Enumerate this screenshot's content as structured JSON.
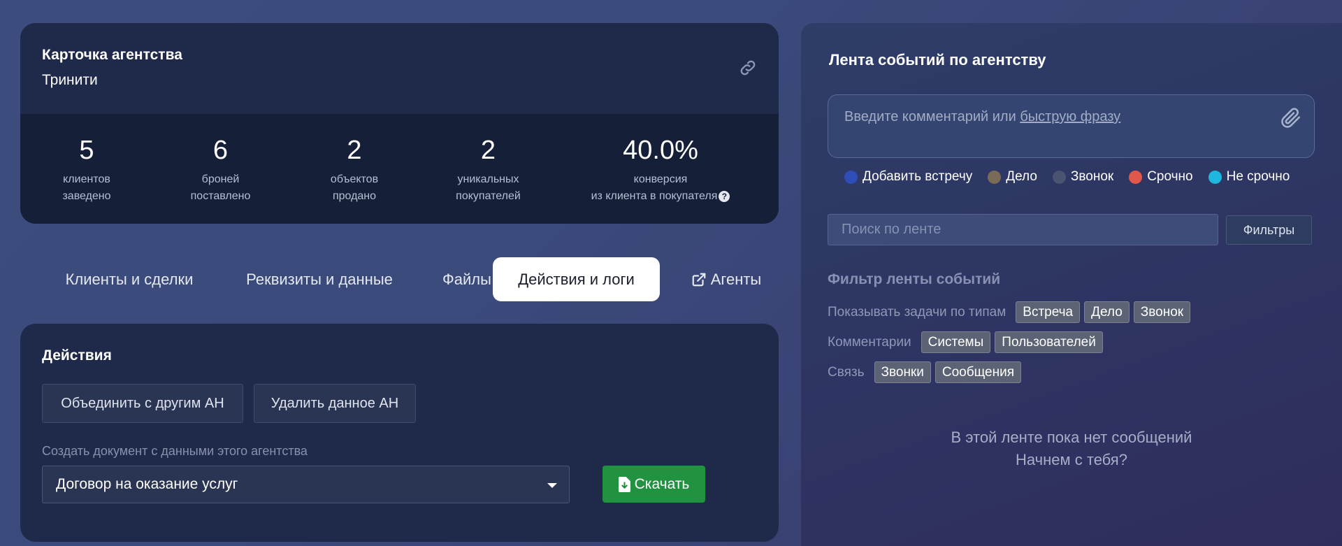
{
  "agency_card": {
    "title": "Карточка агентства",
    "name": "Тринити",
    "stats": [
      {
        "value": "5",
        "label_line1": "клиентов",
        "label_line2": "заведено"
      },
      {
        "value": "6",
        "label_line1": "броней",
        "label_line2": "поставлено"
      },
      {
        "value": "2",
        "label_line1": "объектов",
        "label_line2": "продано"
      },
      {
        "value": "2",
        "label_line1": "уникальных",
        "label_line2": "покупателей"
      },
      {
        "value": "40.0%",
        "label_line1": "конверсия",
        "label_line2": "из клиента в покупателя"
      }
    ]
  },
  "tabs": [
    {
      "label": "Клиенты и сделки"
    },
    {
      "label": "Реквизиты и данные"
    },
    {
      "label": "Файлы"
    },
    {
      "label": "Действия и логи",
      "active": true
    },
    {
      "label": "Агенты",
      "icon": "external-link-icon"
    }
  ],
  "actions": {
    "title": "Действия",
    "merge_label": "Объединить с другим АН",
    "delete_label": "Удалить данное АН",
    "doc_label": "Создать документ с данными этого агентства",
    "doc_selected": "Договор на оказание услуг",
    "download_label": "Скачать"
  },
  "feed": {
    "title": "Лента событий по агентству",
    "comment_placeholder_prefix": "Введите комментарий или ",
    "comment_placeholder_link": "быструю фразу",
    "legend": [
      {
        "label": "Добавить встречу",
        "color": "#2f4db8"
      },
      {
        "label": "Дело",
        "color": "#7a6a58"
      },
      {
        "label": "Звонок",
        "color": "#4a5370"
      },
      {
        "label": "Срочно",
        "color": "#e2574c"
      },
      {
        "label": "Не срочно",
        "color": "#1fb6e0"
      }
    ],
    "search_placeholder": "Поиск по ленте",
    "filters_label": "Фильтры",
    "filter_heading": "Фильтр ленты событий",
    "filter_types_label": "Показывать задачи по типам",
    "filter_types": [
      "Встреча",
      "Дело",
      "Звонок"
    ],
    "filter_comments_label": "Комментарии",
    "filter_comments": [
      "Системы",
      "Пользователей"
    ],
    "filter_comm_label": "Связь",
    "filter_comm": [
      "Звонки",
      "Сообщения"
    ],
    "empty_line1": "В этой ленте пока нет сообщений",
    "empty_line2": "Начнем с тебя?"
  }
}
